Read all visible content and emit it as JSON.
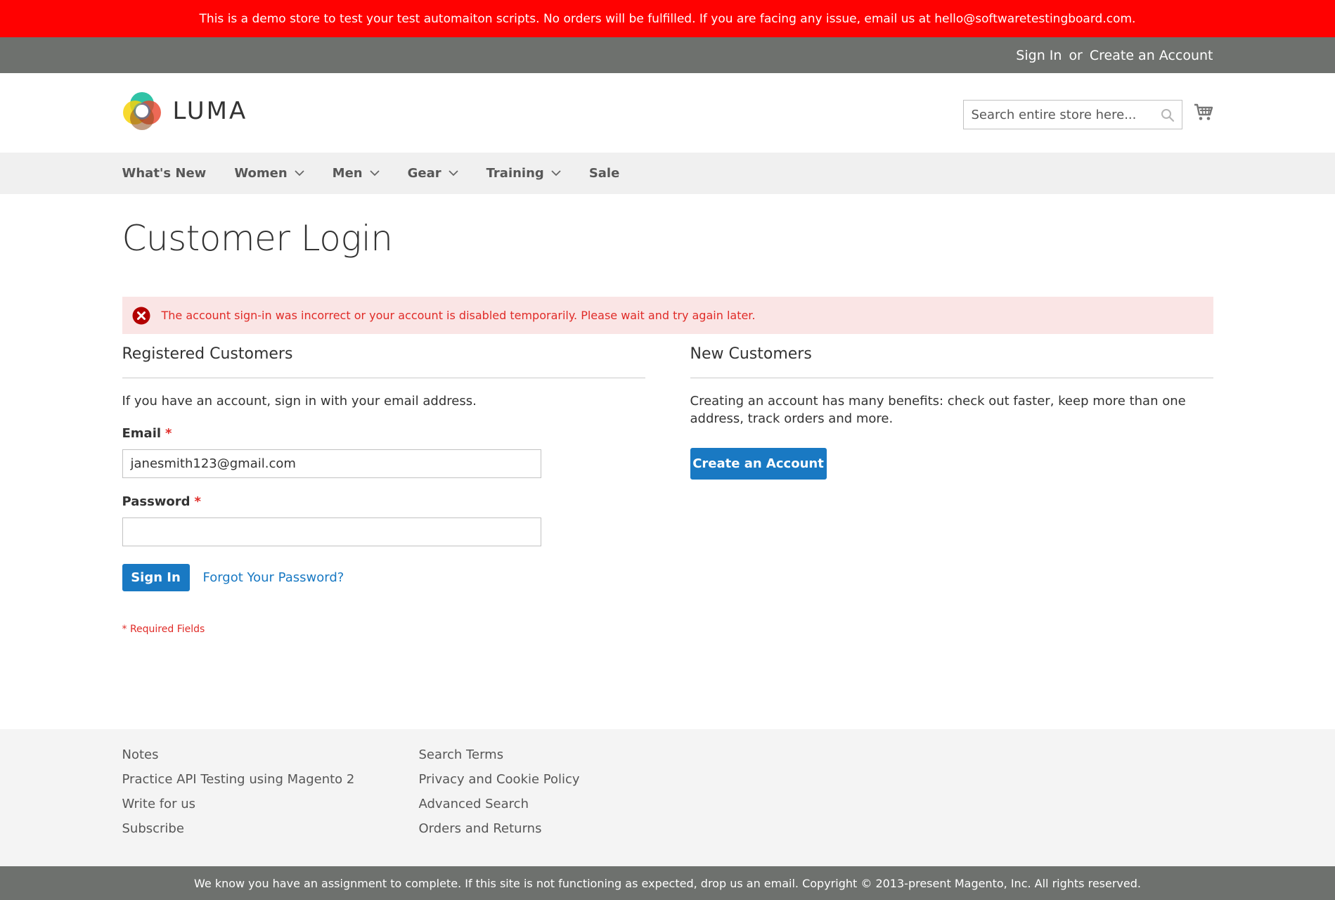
{
  "demo_notice": "This is a demo store to test your test automaiton scripts. No orders will be fulfilled. If you are facing any issue, email us at hello@softwaretestingboard.com.",
  "panel": {
    "sign_in": "Sign In",
    "or": "or",
    "create_account": "Create an Account"
  },
  "logo": {
    "text": "LUMA"
  },
  "search": {
    "placeholder": "Search entire store here..."
  },
  "nav": {
    "items": [
      {
        "label": "What's New"
      },
      {
        "label": "Women"
      },
      {
        "label": "Men"
      },
      {
        "label": "Gear"
      },
      {
        "label": "Training"
      },
      {
        "label": "Sale"
      }
    ]
  },
  "page_title": "Customer Login",
  "error_message": "The account sign-in was incorrect or your account is disabled temporarily. Please wait and try again later.",
  "registered": {
    "title": "Registered Customers",
    "intro": "If you have an account, sign in with your email address.",
    "email_label": "Email",
    "email_value": "janesmith123@gmail.com",
    "password_label": "Password",
    "password_value": "",
    "required_mark": "*",
    "sign_in_button": "Sign In",
    "forgot_link": "Forgot Your Password?",
    "required_note": "* Required Fields"
  },
  "new_customers": {
    "title": "New Customers",
    "intro": "Creating an account has many benefits: check out faster, keep more than one address, track orders and more.",
    "create_button": "Create an Account"
  },
  "footer": {
    "col1": [
      "Notes",
      "Practice API Testing using Magento 2",
      "Write for us",
      "Subscribe"
    ],
    "col2": [
      "Search Terms",
      "Privacy and Cookie Policy",
      "Advanced Search",
      "Orders and Returns"
    ]
  },
  "copyright": "We know you have an assignment to complete. If this site is not functioning as expected, drop us an email. Copyright © 2013-present Magento, Inc. All rights reserved.",
  "colors": {
    "demo_bar": "#ff0101",
    "panel": "#6e716e",
    "primary": "#1979c3",
    "error_bg": "#fae5e5",
    "error_text": "#e02b27"
  },
  "icons": [
    "luma-logo-icon",
    "search-icon",
    "cart-icon",
    "chevron-down-icon",
    "error-icon"
  ]
}
